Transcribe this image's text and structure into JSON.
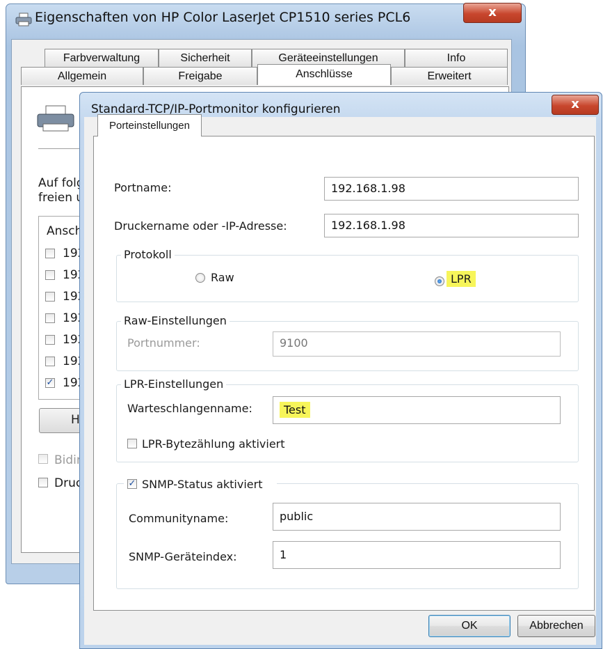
{
  "back_window": {
    "title": "Eigenschaften von HP Color LaserJet CP1510 series PCL6",
    "close_glyph": "x",
    "tabs_row1": [
      "Farbverwaltung",
      "Sicherheit",
      "Geräteeinstellungen",
      "Info"
    ],
    "tabs_row2": [
      "Allgemein",
      "Freigabe",
      "Anschlüsse",
      "Erweitert"
    ],
    "active_tab": "Anschlüsse",
    "description_line1": "Auf folg",
    "description_line2": "freien u",
    "list_header": "Ansch",
    "port_items": [
      {
        "label": "192",
        "checked": false
      },
      {
        "label": "192",
        "checked": false
      },
      {
        "label": "192",
        "checked": false
      },
      {
        "label": "192",
        "checked": false
      },
      {
        "label": "192",
        "checked": false
      },
      {
        "label": "192",
        "checked": false
      },
      {
        "label": "192",
        "checked": true
      }
    ],
    "button_partial": "H",
    "bidir_label": "Bidir",
    "druck_label": "Druc"
  },
  "dialog": {
    "title": "Standard-TCP/IP-Portmonitor konfigurieren",
    "close_glyph": "x",
    "tab_label": "Porteinstellungen",
    "portname_label": "Portname:",
    "portname_value": "192.168.1.98",
    "ip_label": "Druckername oder -IP-Adresse:",
    "ip_value": "192.168.1.98",
    "protocol": {
      "legend": "Protokoll",
      "raw_label": "Raw",
      "lpr_label": "LPR",
      "selected": "LPR"
    },
    "raw_settings": {
      "legend": "Raw-Einstellungen",
      "portnumber_label": "Portnummer:",
      "portnumber_value": "9100"
    },
    "lpr_settings": {
      "legend": "LPR-Einstellungen",
      "queue_label": "Warteschlangenname:",
      "queue_value": "Test",
      "bytecount_label": "LPR-Bytezählung aktiviert",
      "bytecount_checked": false
    },
    "snmp": {
      "enabled_label": "SNMP-Status aktiviert",
      "enabled": true,
      "community_label": "Communityname:",
      "community_value": "public",
      "index_label": "SNMP-Geräteindex:",
      "index_value": "1"
    },
    "ok_label": "OK",
    "cancel_label": "Abbrechen"
  },
  "colors": {
    "highlight": "#f7f55a",
    "close_button": "#c8472e",
    "titlebar": "#c3d7ee"
  }
}
